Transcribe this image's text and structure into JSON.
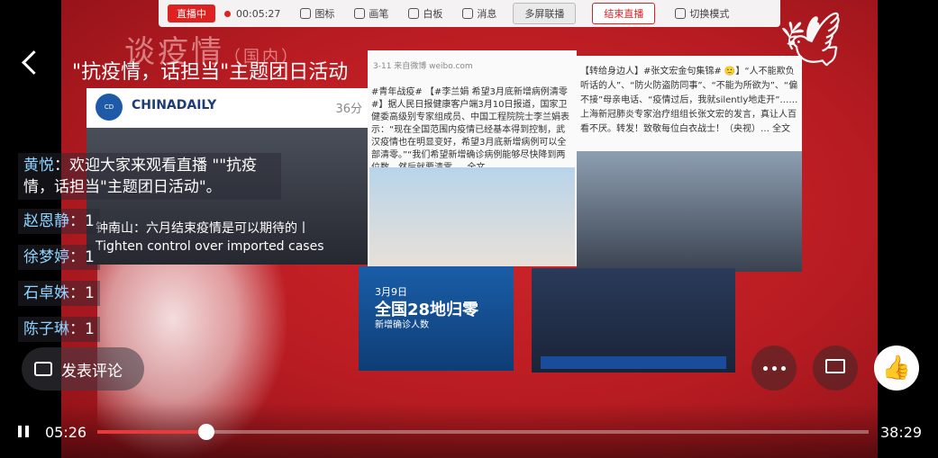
{
  "title": "\"抗疫情，话担当\"主题团日活动",
  "slide": {
    "heading": "谈疫情",
    "heading_sub": "（国内）",
    "toolbar": {
      "live": "直播中",
      "time": "00:05:27",
      "items": [
        "图标",
        "画笔",
        "白板",
        "消息"
      ],
      "multi_screen": "多屏联播",
      "end_live": "结束直播",
      "switch_mode": "切换模式"
    },
    "panel1": {
      "brand": "CHINADAILY",
      "count": "36分",
      "caption_cn": "钟南山：六月结束疫情是可以期待的丨",
      "caption_en": "Tighten control over imported cases"
    },
    "panel2": {
      "header": "3-11 来自微博 weibo.com",
      "text": "#青年战疫# 【#李兰娟 希望3月底新增病例清零#】据人民日报健康客户端3月10日报道，国家卫健委高级别专家组成员、中国工程院院士李兰娟表示：“现在全国范围内疫情已经基本得到控制，武汉疫情也在明显变好，希望3月底新增病例可以全部清零。”“我们希望新增确诊病例能够尽快降到两位数，然后就要清零 … 全文"
    },
    "panel3": {
      "text": "【转给身边人】#张文宏金句集锦# 🙂】“人不能欺负听话的人”、“防火防盗防同事”、“不能为所欲为”、“偏不接”母亲电话、“疫情过后，我就silently地走开”……上海新冠肺炎专家治疗组组长张文宏的发言，真让人百看不厌。转发！致敬每位白衣战士！（央视）… 全文"
    },
    "panel4": {
      "date": "3月9日",
      "headline": "全国28地归零",
      "sub": "新增确诊人数"
    }
  },
  "comments": [
    {
      "user": "黄悦",
      "text": "欢迎大家来观看直播 \"\"抗疫情，话担当\"主题团日活动\"。"
    },
    {
      "user": "赵恩静",
      "text": "1"
    },
    {
      "user": "徐梦婷",
      "text": "1"
    },
    {
      "user": "石卓姝",
      "text": "1"
    },
    {
      "user": "陈子琳",
      "text": "1"
    }
  ],
  "comment_button": "发表评论",
  "icons": {
    "back": "back-icon",
    "more": "more-icon",
    "cast": "cast-icon",
    "like": "like-icon",
    "pause": "pause-icon",
    "comment": "comment-icon"
  },
  "player": {
    "current": "05:26",
    "total": "38:29",
    "progress": 0.1413
  }
}
